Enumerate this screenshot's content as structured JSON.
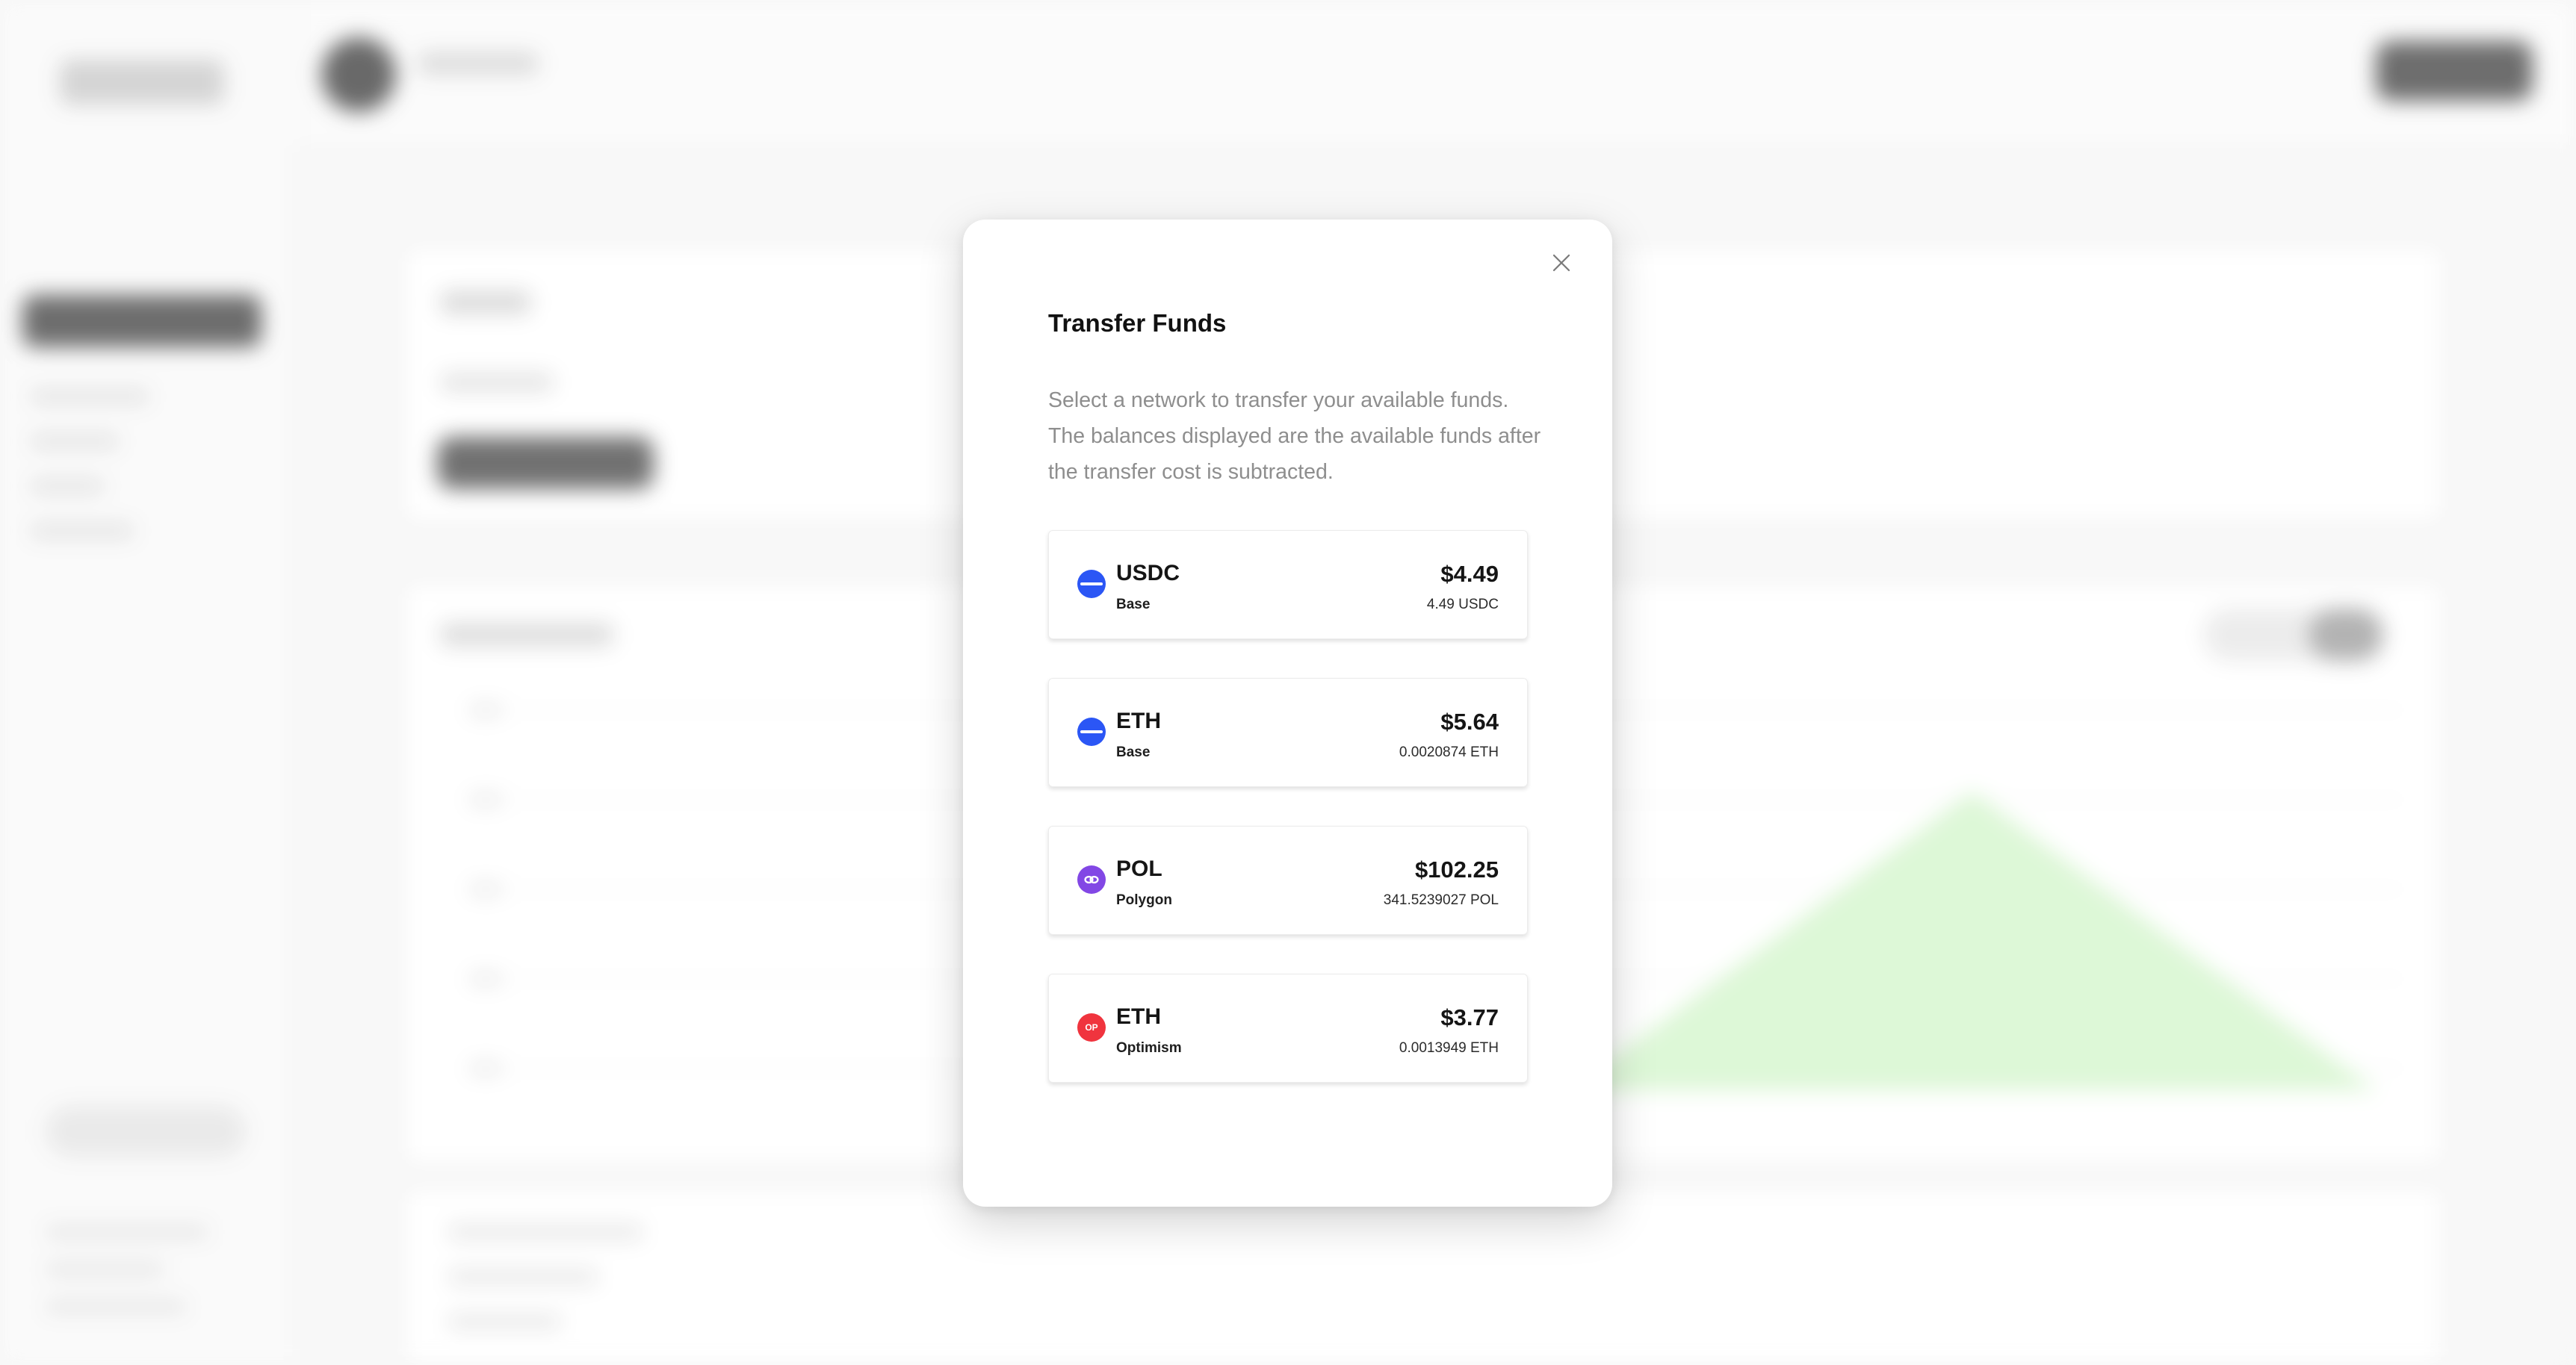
{
  "modal": {
    "title": "Transfer Funds",
    "description": "Select a network to transfer your available funds. The balances displayed are the available funds after the transfer cost is subtracted.",
    "close_icon": "close-icon"
  },
  "funds": [
    {
      "token": "USDC",
      "network": "Base",
      "usd": "$4.49",
      "amount": "4.49 USDC",
      "icon": "base-icon",
      "color": "#2b56f5"
    },
    {
      "token": "ETH",
      "network": "Base",
      "usd": "$5.64",
      "amount": "0.0020874 ETH",
      "icon": "base-icon",
      "color": "#2b56f5"
    },
    {
      "token": "POL",
      "network": "Polygon",
      "usd": "$102.25",
      "amount": "341.5239027 POL",
      "icon": "polygon-icon",
      "color": "#8247e5"
    },
    {
      "token": "ETH",
      "network": "Optimism",
      "usd": "$3.77",
      "amount": "0.0013949 ETH",
      "icon": "optimism-icon",
      "icon_text": "OP",
      "color": "#f0343e"
    }
  ]
}
